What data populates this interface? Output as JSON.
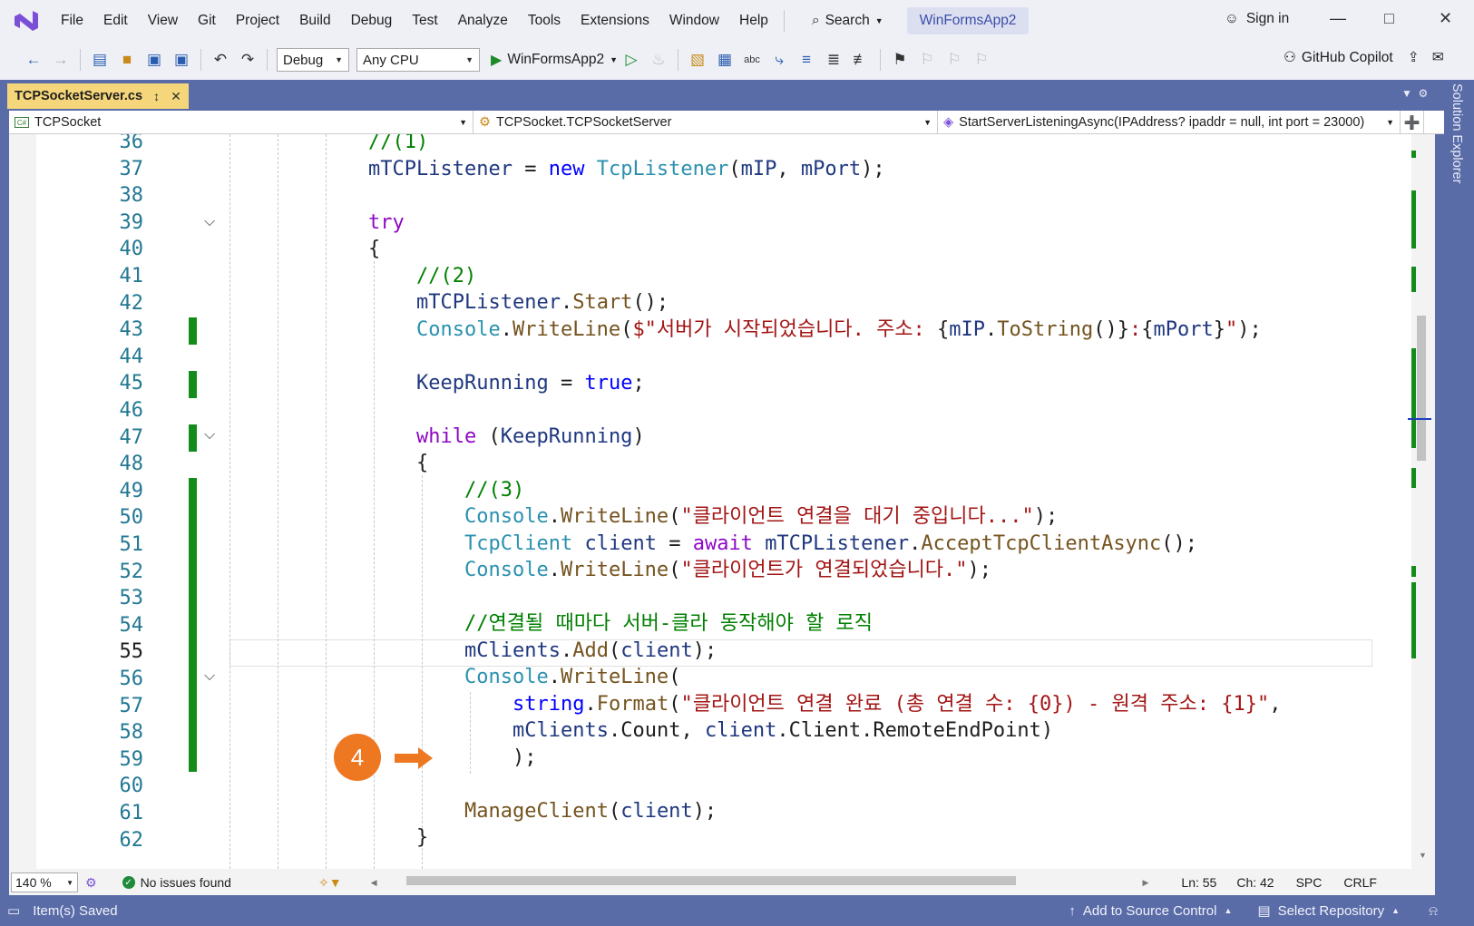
{
  "menubar": {
    "items": [
      "File",
      "Edit",
      "View",
      "Git",
      "Project",
      "Build",
      "Debug",
      "Test",
      "Analyze",
      "Tools",
      "Extensions",
      "Window",
      "Help"
    ],
    "search_label": "Search",
    "solution_name": "WinFormsApp2",
    "signin_label": "Sign in"
  },
  "toolbar": {
    "config": "Debug",
    "platform": "Any CPU",
    "run_target": "WinFormsApp2",
    "copilot_label": "GitHub Copilot"
  },
  "tab": {
    "title": "TCPSocketServer.cs"
  },
  "sidebar": {
    "label": "Solution Explorer"
  },
  "navbar": {
    "project": "TCPSocket",
    "class": "TCPSocket.TCPSocketServer",
    "member": "StartServerListeningAsync(IPAddress? ipaddr = null, int port = 23000)"
  },
  "editor": {
    "line_numbers": [
      "36",
      "37",
      "38",
      "39",
      "40",
      "41",
      "42",
      "43",
      "44",
      "45",
      "46",
      "47",
      "48",
      "49",
      "50",
      "51",
      "52",
      "53",
      "54",
      "55",
      "56",
      "57",
      "58",
      "59",
      "60",
      "61",
      "62"
    ],
    "current_line": "55",
    "badge": "4"
  },
  "status": {
    "zoom": "140 %",
    "issues": "No issues found",
    "ln": "Ln: 55",
    "ch": "Ch: 42",
    "spc": "SPC",
    "crlf": "CRLF"
  },
  "bottombar": {
    "saved": "Item(s) Saved",
    "source_control": "Add to Source Control",
    "repository": "Select Repository"
  },
  "colors": {
    "accent": "#5a6ca8",
    "tab": "#f5d67a",
    "changed": "#148c1c",
    "badge": "#ee7722"
  }
}
